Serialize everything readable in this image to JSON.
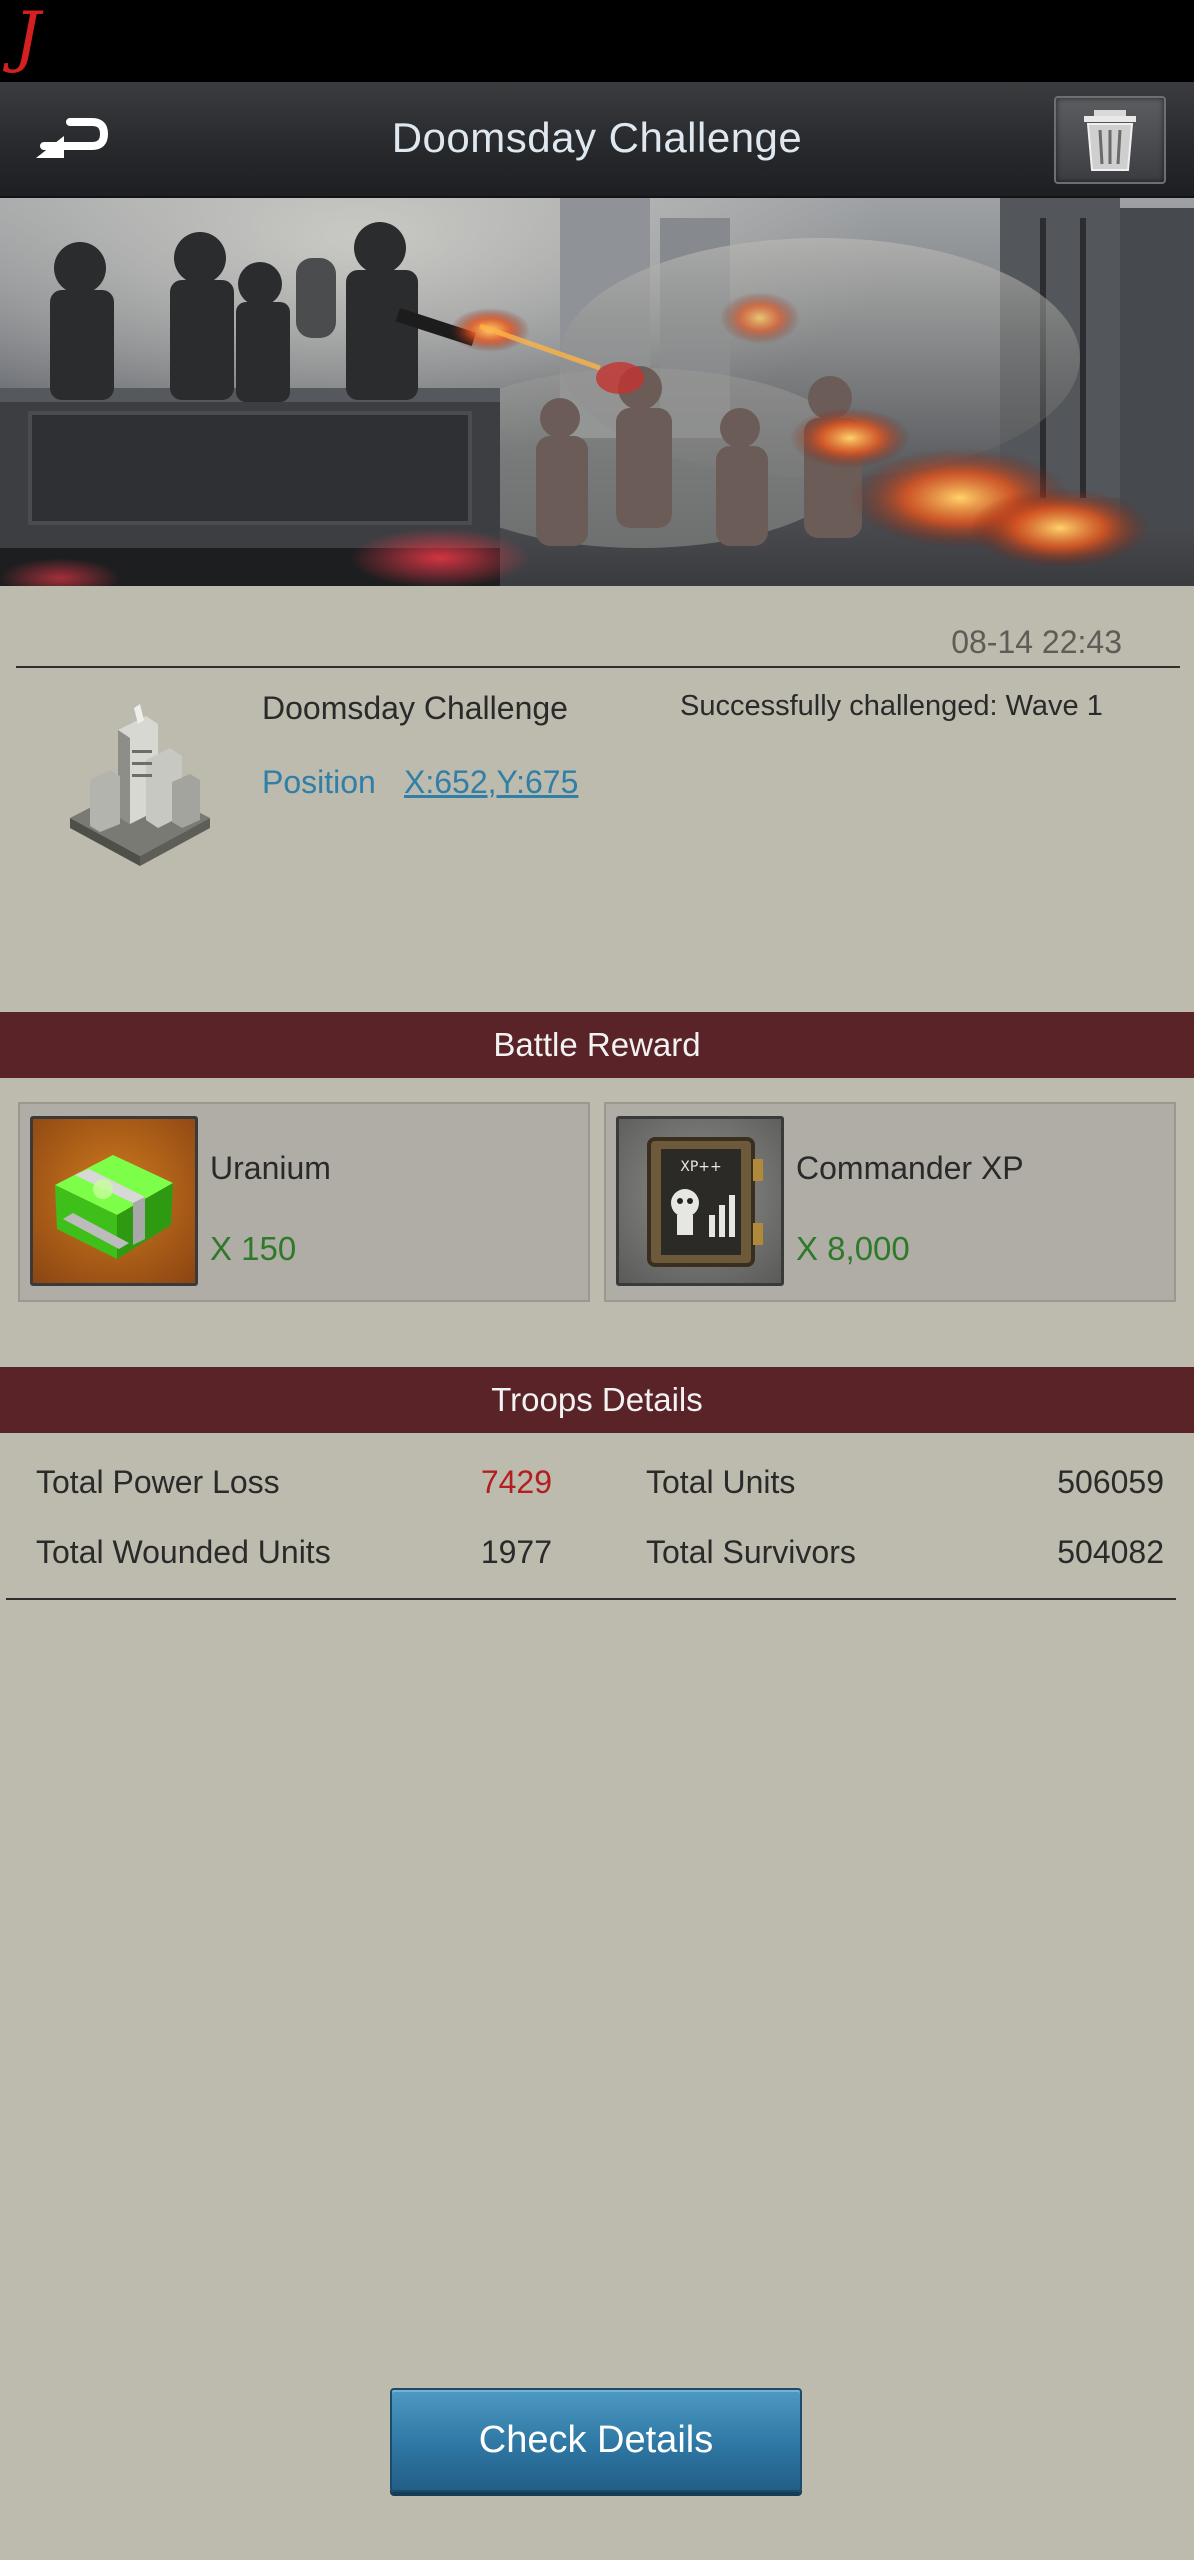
{
  "status_bar": {
    "mark": "J"
  },
  "header": {
    "title": "Doomsday Challenge"
  },
  "report": {
    "timestamp": "08-14 22:43",
    "title": "Doomsday Challenge",
    "status": "Successfully challenged: Wave 1",
    "position_label": "Position",
    "position_value": "X:652,Y:675"
  },
  "battle_reward": {
    "title": "Battle Reward",
    "items": [
      {
        "name": "Uranium",
        "quantity": "X 150",
        "icon": "uranium-crate-icon"
      },
      {
        "name": "Commander XP",
        "quantity": "X 8,000",
        "icon": "xp-book-icon"
      }
    ]
  },
  "troops": {
    "title": "Troops Details",
    "rows": [
      {
        "label": "Total Power Loss",
        "value": "7429"
      },
      {
        "label": "Total Units",
        "value": "506059"
      },
      {
        "label": "Total Wounded Units",
        "value": "1977"
      },
      {
        "label": "Total Survivors",
        "value": "504082"
      }
    ]
  },
  "actions": {
    "check_details": "Check Details"
  },
  "colors": {
    "section_bar": "#5a2328",
    "link": "#2f7fa6",
    "reward_qty": "#2f7a2a",
    "power_loss": "#b31f1f",
    "button": "#2e77a4"
  }
}
